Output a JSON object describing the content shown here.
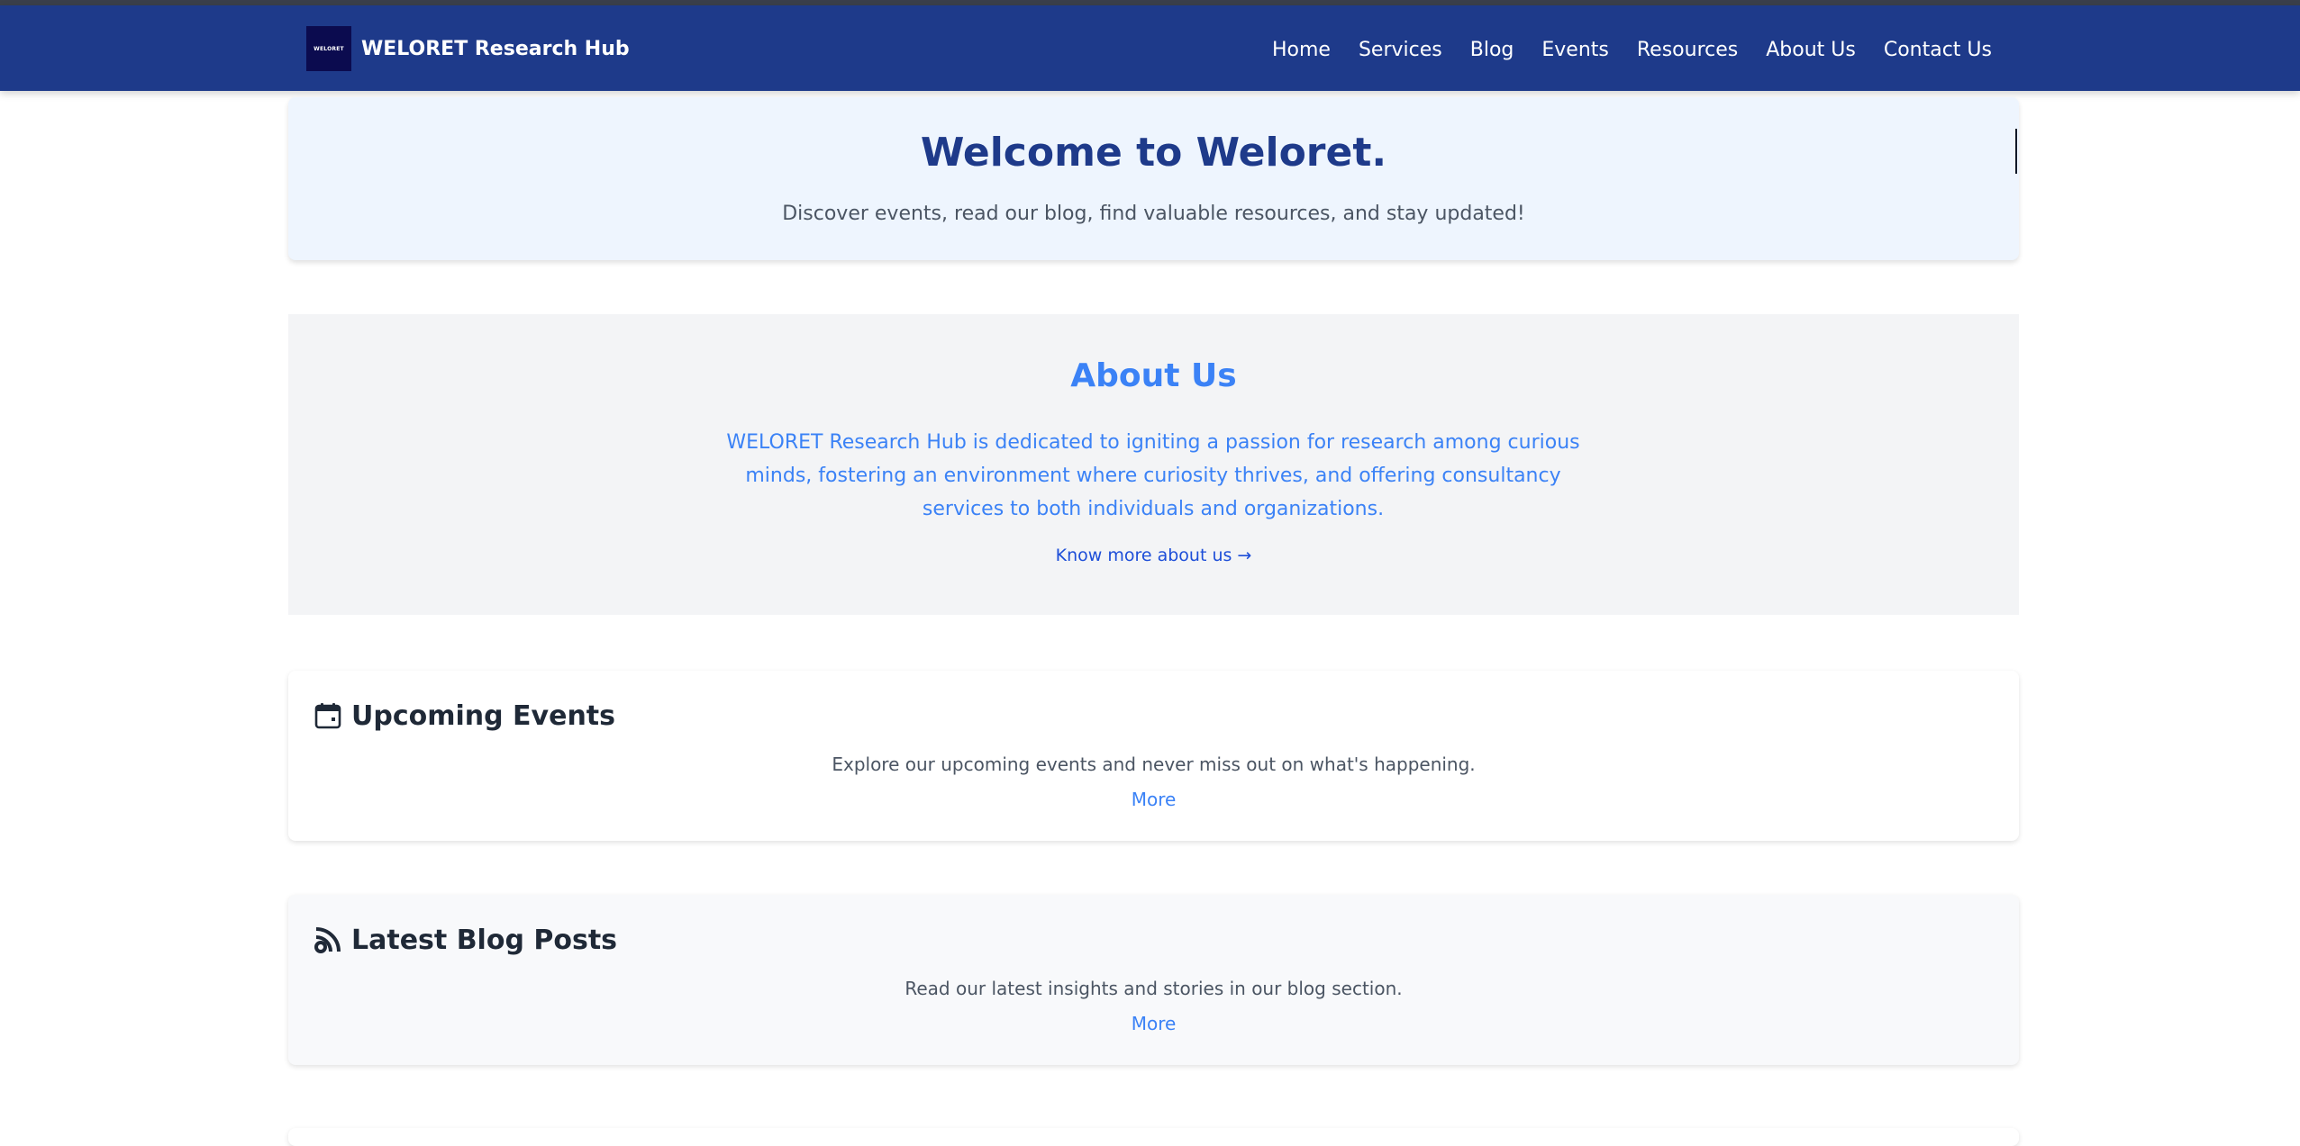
{
  "header": {
    "logo_text": "WELORET",
    "brand_name": "WELORET Research Hub",
    "nav": [
      "Home",
      "Services",
      "Blog",
      "Events",
      "Resources",
      "About Us",
      "Contact Us"
    ]
  },
  "hero": {
    "title": "Welcome to Weloret.",
    "subtitle": "Discover events, read our blog, find valuable resources, and stay updated!"
  },
  "about": {
    "title": "About Us",
    "description": "WELORET Research Hub is dedicated to igniting a passion for research among curious minds, fostering an environment where curiosity thrives, and offering consultancy services to both individuals and organizations.",
    "link": "Know more about us →"
  },
  "events": {
    "icon": "calendar-icon",
    "title": "Upcoming Events",
    "text": "Explore our upcoming events and never miss out on what's happening.",
    "more": "More"
  },
  "blog": {
    "icon": "rss-icon",
    "title": "Latest Blog Posts",
    "text": "Read our latest insights and stories in our blog section.",
    "more": "More"
  },
  "colors": {
    "navbar": "#1e3a8a",
    "accent_blue": "#3b82f6",
    "hero_bg": "#eef5fe",
    "about_bg": "#f3f4f6"
  }
}
